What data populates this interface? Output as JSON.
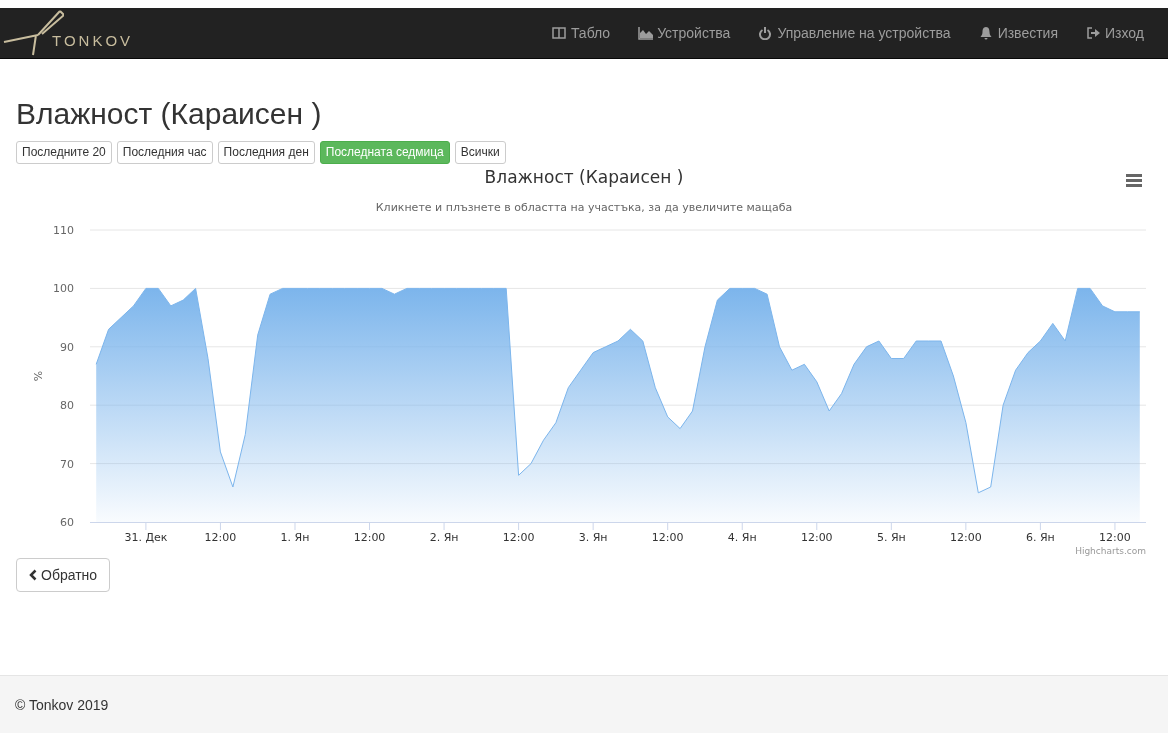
{
  "navbar": {
    "brand": "TONKOV",
    "items": [
      {
        "label": "Табло"
      },
      {
        "label": "Устройства"
      },
      {
        "label": "Управление на устройства"
      },
      {
        "label": "Известия"
      },
      {
        "label": "Изход"
      }
    ]
  },
  "page": {
    "title": "Влажност (Караисен )"
  },
  "ranges": [
    {
      "label": "Последните 20",
      "selected": false
    },
    {
      "label": "Последния час",
      "selected": false
    },
    {
      "label": "Последния ден",
      "selected": false
    },
    {
      "label": "Последната седмица",
      "selected": true
    },
    {
      "label": "Всички",
      "selected": false
    }
  ],
  "chart": {
    "subtitle": "Кликнете и плъзнете в областта на участъка, за да увеличите мащаба",
    "credits": "Highcharts.com",
    "chart_data": {
      "type": "area",
      "title": "Влажност (Караисен )",
      "ylabel": "%",
      "grid": true,
      "ylim": [
        60,
        110
      ],
      "yticks": [
        60,
        70,
        80,
        90,
        100,
        110
      ],
      "categories": [
        null,
        null,
        null,
        null,
        "31. Дек",
        null,
        null,
        null,
        null,
        null,
        "12:00",
        null,
        null,
        null,
        null,
        null,
        "1. Ян",
        null,
        null,
        null,
        null,
        null,
        "12:00",
        null,
        null,
        null,
        null,
        null,
        "2. Ян",
        null,
        null,
        null,
        null,
        null,
        "12:00",
        null,
        null,
        null,
        null,
        null,
        "3. Ян",
        null,
        null,
        null,
        null,
        null,
        "12:00",
        null,
        null,
        null,
        null,
        null,
        "4. Ян",
        null,
        null,
        null,
        null,
        null,
        "12:00",
        null,
        null,
        null,
        null,
        null,
        "5. Ян",
        null,
        null,
        null,
        null,
        null,
        "12:00",
        null,
        null,
        null,
        null,
        null,
        "6. Ян",
        null,
        null,
        null,
        null,
        null,
        "12:00",
        null,
        null
      ],
      "series": [
        {
          "color": "#7cb5ec",
          "values": [
            87,
            93,
            95,
            97,
            100,
            100,
            97,
            98,
            100,
            88,
            72,
            66,
            75,
            92,
            99,
            100,
            100,
            100,
            100,
            100,
            100,
            100,
            100,
            100,
            99,
            100,
            100,
            100,
            100,
            100,
            100,
            100,
            100,
            100,
            68,
            70,
            74,
            77,
            83,
            86,
            89,
            90,
            91,
            93,
            91,
            83,
            78,
            76,
            79,
            90,
            98,
            100,
            100,
            100,
            99,
            90,
            86,
            87,
            84,
            79,
            82,
            87,
            90,
            91,
            88,
            88,
            91,
            91,
            91,
            85,
            77,
            65,
            66,
            80,
            86,
            89,
            91,
            94,
            91,
            100,
            100,
            97,
            96,
            96,
            96
          ]
        }
      ]
    }
  },
  "back": {
    "label": "Обратно"
  },
  "footer": {
    "text": "© Tonkov 2019"
  }
}
